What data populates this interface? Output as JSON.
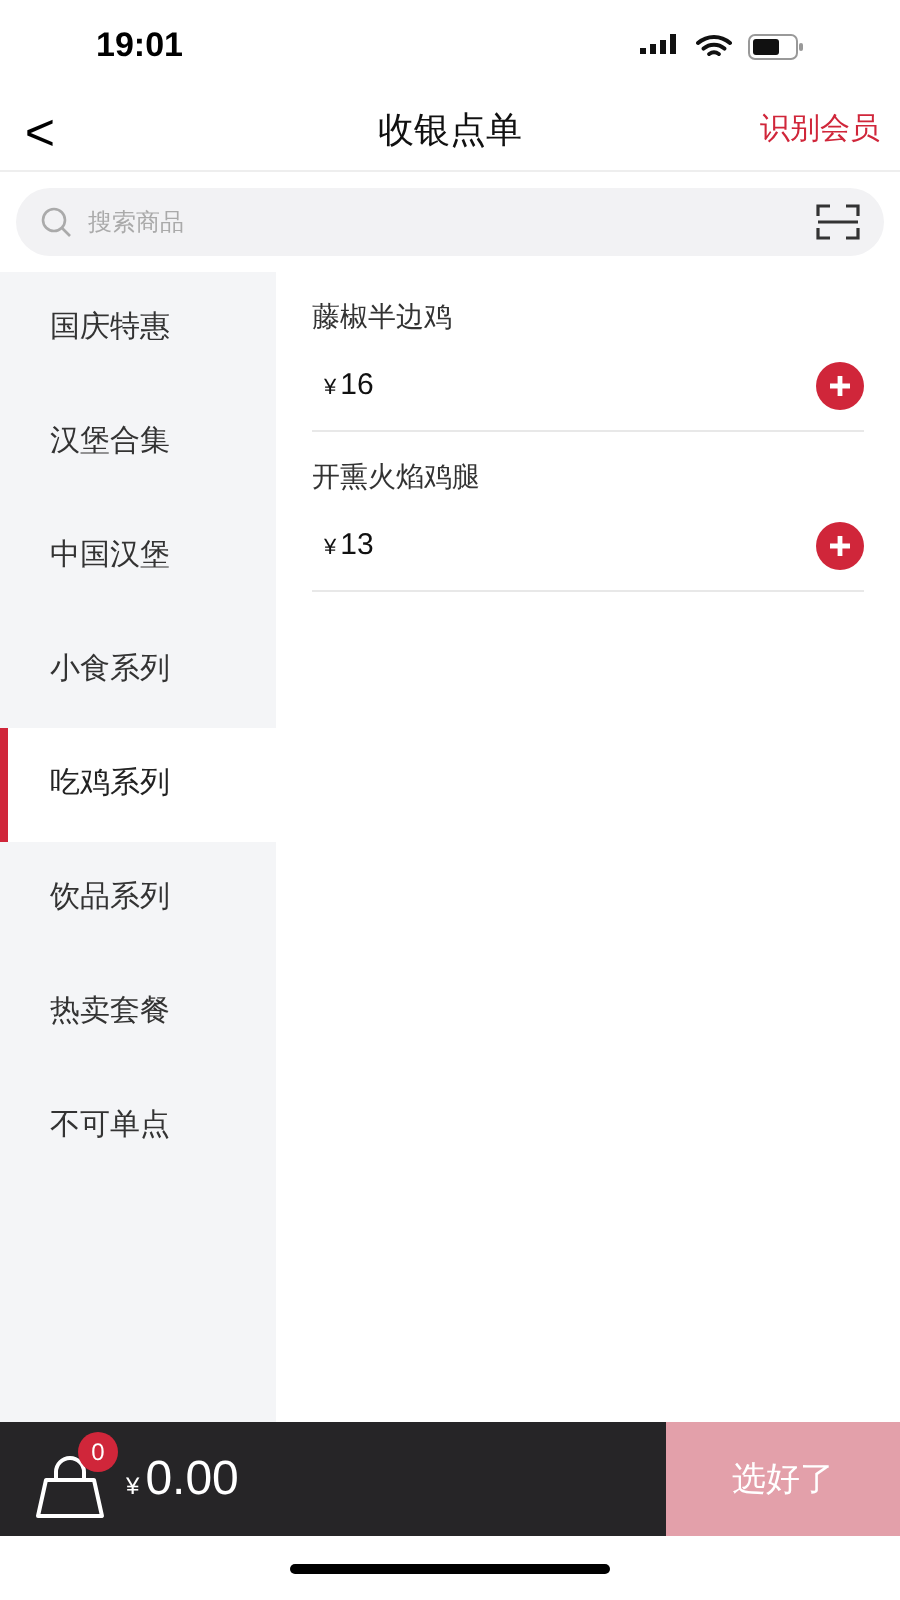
{
  "status_bar": {
    "time": "19:01"
  },
  "nav": {
    "back": "<",
    "title": "收银点单",
    "action": "识别会员"
  },
  "search": {
    "placeholder": "搜索商品"
  },
  "categories": [
    {
      "label": "国庆特惠",
      "selected": false
    },
    {
      "label": "汉堡合集",
      "selected": false
    },
    {
      "label": "中国汉堡",
      "selected": false
    },
    {
      "label": "小食系列",
      "selected": false
    },
    {
      "label": "吃鸡系列",
      "selected": true
    },
    {
      "label": "饮品系列",
      "selected": false
    },
    {
      "label": "热卖套餐",
      "selected": false
    },
    {
      "label": "不可单点",
      "selected": false
    }
  ],
  "products": [
    {
      "name": "藤椒半边鸡",
      "currency": "¥",
      "price": "16"
    },
    {
      "name": "开熏火焰鸡腿",
      "currency": "¥",
      "price": "13"
    }
  ],
  "cart": {
    "count": "0",
    "currency": "¥",
    "total": "0.00",
    "checkout": {
      "label": "选好了",
      "disabled": true
    }
  }
}
